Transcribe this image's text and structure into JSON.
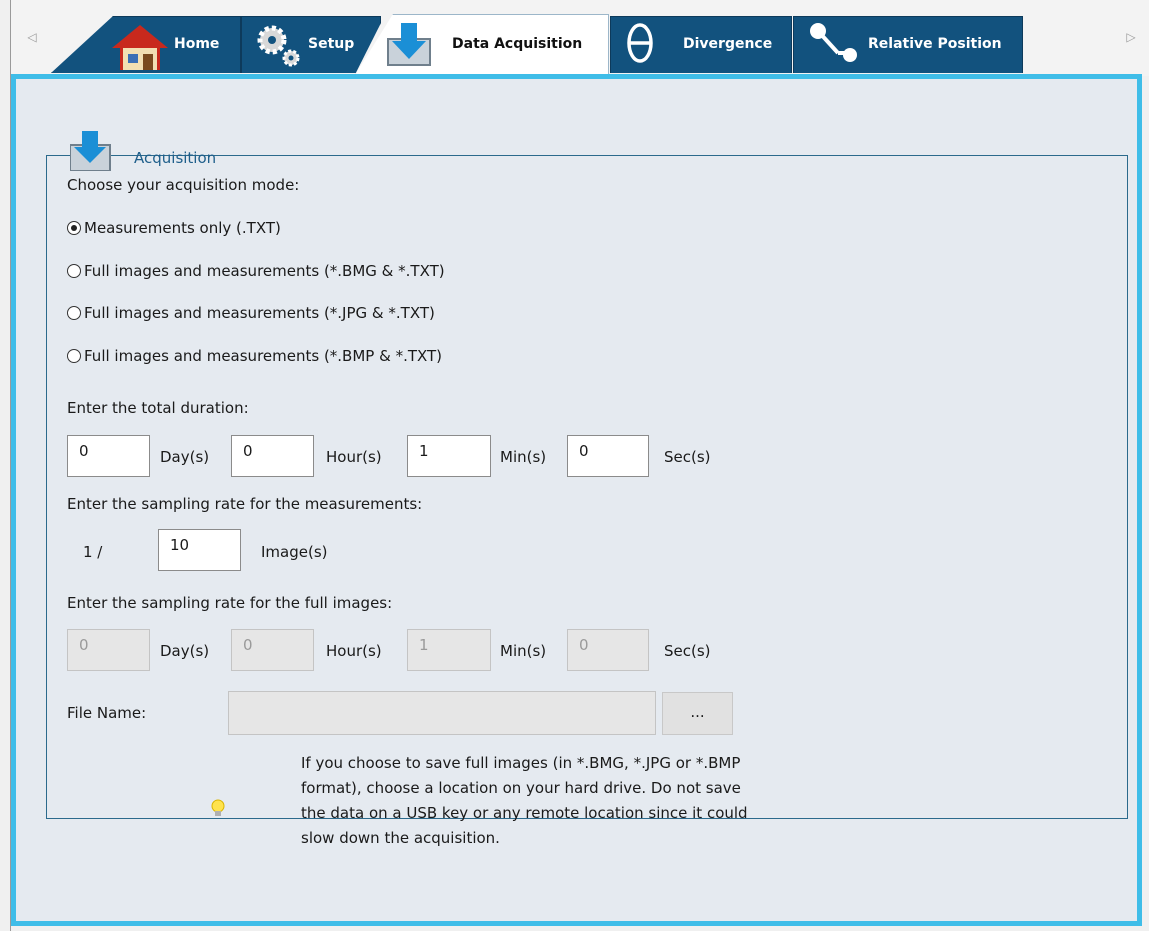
{
  "tabs": [
    {
      "label": "Home",
      "icon": "home-icon",
      "active": false
    },
    {
      "label": "Setup",
      "icon": "gears-icon",
      "active": false
    },
    {
      "label": "Data Acquisition",
      "icon": "download-icon",
      "active": true
    },
    {
      "label": "Divergence",
      "icon": "theta-icon",
      "active": false
    },
    {
      "label": "Relative Position",
      "icon": "connector-icon",
      "active": false
    }
  ],
  "tab_arrows": {
    "left": "◁",
    "right": "▷"
  },
  "group": {
    "title": "Acquisition"
  },
  "mode": {
    "prompt": "Choose your acquisition mode:",
    "options": [
      {
        "label": "Measurements only (.TXT)",
        "checked": true
      },
      {
        "label": "Full images and measurements (*.BMG & *.TXT)",
        "checked": false
      },
      {
        "label": "Full images and measurements (*.JPG  & *.TXT)",
        "checked": false
      },
      {
        "label": "Full images and measurements (*.BMP & *.TXT)",
        "checked": false
      }
    ]
  },
  "duration": {
    "prompt": "Enter the total duration:",
    "days": "0",
    "days_unit": "Day(s)",
    "hours": "0",
    "hours_unit": "Hour(s)",
    "mins": "1",
    "mins_unit": "Min(s)",
    "secs": "0",
    "secs_unit": "Sec(s)"
  },
  "measurement_rate": {
    "prompt": "Enter the sampling rate for the measurements:",
    "prefix": "1 /",
    "value": "10",
    "unit": "Image(s)"
  },
  "image_rate": {
    "prompt": "Enter the sampling rate for the full images:",
    "days": "0",
    "days_unit": "Day(s)",
    "hours": "0",
    "hours_unit": "Hour(s)",
    "mins": "1",
    "mins_unit": "Min(s)",
    "secs": "0",
    "secs_unit": "Sec(s)"
  },
  "file": {
    "label": "File Name:",
    "value": "",
    "browse_label": "..."
  },
  "hint": {
    "icon": "lightbulb-icon",
    "text": "If you choose to save full images (in *.BMG, *.JPG or *.BMP format), choose a location on your hard drive. Do not save the data on a USB key or any remote location since it could slow down the acquisition."
  },
  "colors": {
    "tab_bg": "#12527e",
    "panel_bg": "#e5eaf0",
    "panel_border": "#3fbde8",
    "group_title": "#1f5f8b"
  }
}
